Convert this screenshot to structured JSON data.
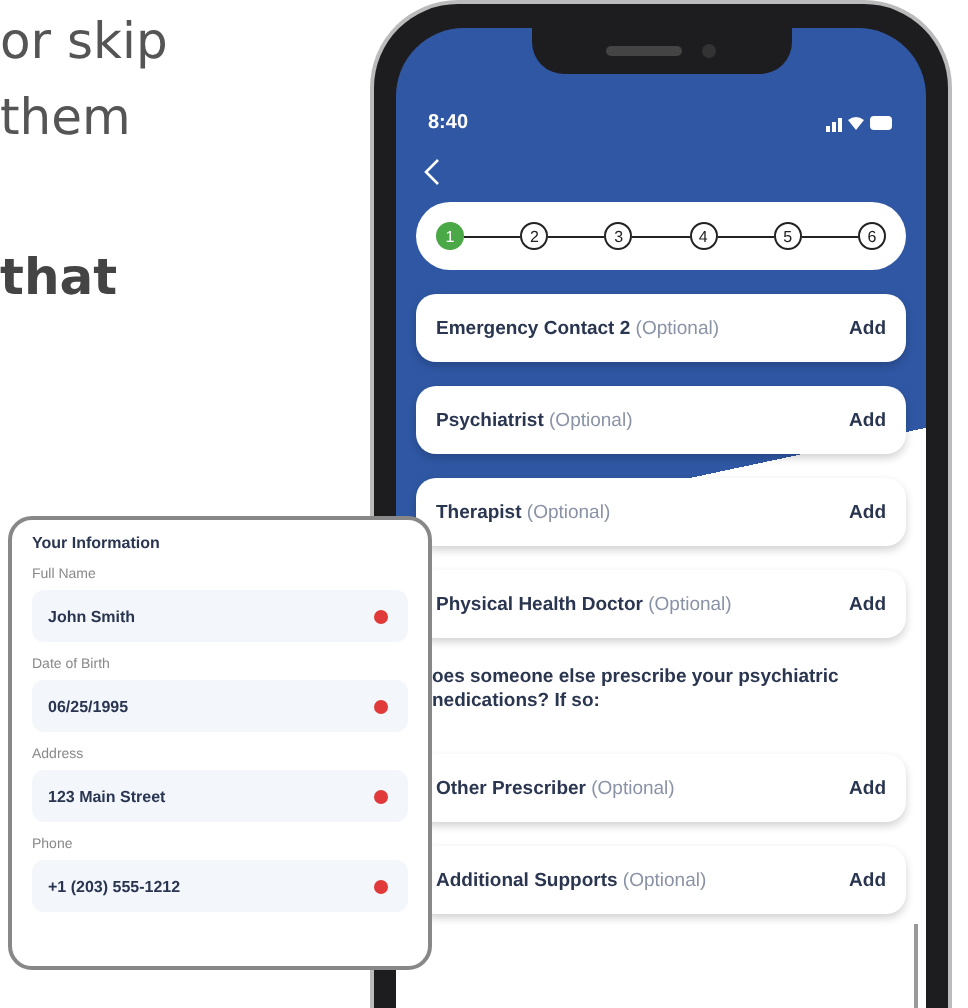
{
  "intro_lines": [
    {
      "text": "or skip",
      "kind": "regular"
    },
    {
      "text": "them",
      "kind": "regular"
    },
    {
      "text": "that",
      "kind": "bold"
    }
  ],
  "phone": {
    "status_bar": {
      "time": "8:40"
    },
    "steps": [
      {
        "label": "1",
        "selected": true
      },
      {
        "label": "2",
        "selected": false
      },
      {
        "label": "3",
        "selected": false
      },
      {
        "label": "4",
        "selected": false
      },
      {
        "label": "5",
        "selected": false
      },
      {
        "label": "6",
        "selected": false
      }
    ],
    "items": [
      {
        "kind": "entry",
        "title": "Emergency Contact 2",
        "note": "(Optional)",
        "action": "Add"
      },
      {
        "kind": "entry",
        "title": "Psychiatrist",
        "note": "(Optional)",
        "action": "Add"
      },
      {
        "kind": "entry",
        "title": "Therapist",
        "note": "(Optional)",
        "action": "Add"
      },
      {
        "kind": "entry",
        "title": "Physical Health Doctor",
        "note": "(Optional)",
        "action": "Add"
      },
      {
        "kind": "question",
        "lines": [
          "oes someone else prescribe your psychiatric",
          "nedications? If so:"
        ]
      },
      {
        "kind": "entry",
        "title": "Other Prescriber",
        "note": "(Optional)",
        "action": "Add"
      },
      {
        "kind": "entry",
        "title": "Additional Supports",
        "note": "(Optional)",
        "action": "Add"
      }
    ]
  },
  "info_card": {
    "title": "Your Information",
    "fields": [
      {
        "label": "Full Name",
        "value": "John Smith",
        "color": "#e03a3a"
      },
      {
        "label": "Date of Birth",
        "value": "06/25/1995",
        "color": "#e03a3a"
      },
      {
        "label": "Address",
        "value": "123 Main Street",
        "color": "#e03a3a"
      },
      {
        "label": "Phone",
        "value": "+1 (203) 555-1212",
        "color": "#e03a3a"
      }
    ]
  }
}
